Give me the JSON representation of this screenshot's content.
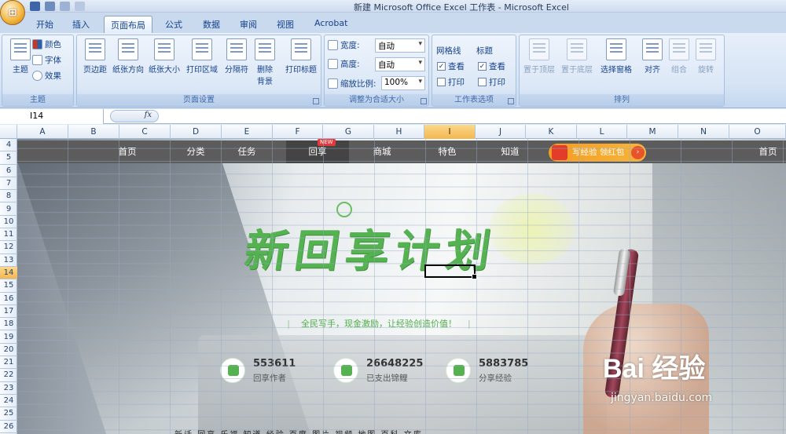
{
  "window": {
    "title": "新建 Microsoft Office Excel 工作表 - Microsoft Excel",
    "office_button_label": "⊞"
  },
  "tabs": [
    "开始",
    "插入",
    "页面布局",
    "公式",
    "数据",
    "审阅",
    "视图",
    "Acrobat"
  ],
  "active_tab": "页面布局",
  "ribbon": {
    "theme_group": {
      "label": "主题",
      "themes_button": "主题",
      "colors": "颜色",
      "fonts": "字体",
      "effects": "效果"
    },
    "page_setup_group": {
      "label": "页面设置",
      "buttons": [
        "页边距",
        "纸张方向",
        "纸张大小",
        "打印区域",
        "分隔符",
        "删除背景",
        "打印标题"
      ]
    },
    "scale_group": {
      "label": "调整为合适大小",
      "width_label": "宽度:",
      "width_value": "自动",
      "height_label": "高度:",
      "height_value": "自动",
      "scale_label": "缩放比例:",
      "scale_value": "100%"
    },
    "sheet_options_group": {
      "label": "工作表选项",
      "gridlines_title": "网格线",
      "headings_title": "标题",
      "view_label": "查看",
      "print_label": "打印",
      "gridlines_view": true,
      "gridlines_print": false,
      "headings_view": true,
      "headings_print": false
    },
    "arrange_group": {
      "label": "排列",
      "buttons": [
        "置于顶层",
        "置于底层",
        "选择窗格",
        "对齐",
        "组合",
        "旋转"
      ]
    }
  },
  "formula_bar": {
    "name_box": "I14",
    "fx_label": "fx",
    "content": ""
  },
  "columns": [
    "A",
    "B",
    "C",
    "D",
    "E",
    "F",
    "G",
    "H",
    "I",
    "J",
    "K",
    "L",
    "M",
    "N",
    "O"
  ],
  "selected_column": "I",
  "rows": [
    "4",
    "5",
    "6",
    "7",
    "8",
    "9",
    "10",
    "11",
    "12",
    "13",
    "14",
    "15",
    "16",
    "17",
    "18",
    "19",
    "20",
    "21",
    "22",
    "23",
    "24",
    "25",
    "26"
  ],
  "selected_row": "14",
  "embedded_page": {
    "nav": [
      "首页",
      "分类",
      "任务",
      "回享",
      "商城",
      "特色",
      "知道"
    ],
    "nav_right": "首页",
    "new_badge": "NEW",
    "promo_text": "写经验 领红包",
    "hero_title": "新回享计划",
    "tagline": "全民写手，现金激励，让经验创造价值！",
    "stats": [
      {
        "number": "553611",
        "label": "回享作者"
      },
      {
        "number": "26648225",
        "label": "已支出锦鲤"
      },
      {
        "number": "5883785",
        "label": "分享经验"
      }
    ],
    "footer": "新话  回享  乐福  知道  经验  百度  图片  视频  地图  百科  文库"
  },
  "watermark": {
    "logo": "Bai  经验",
    "url": "jingyan.baidu.com"
  },
  "colors": {
    "brand_green": "#54b251",
    "selection_orange": "#f3b651",
    "nav_bg": "#5c5c5c"
  }
}
